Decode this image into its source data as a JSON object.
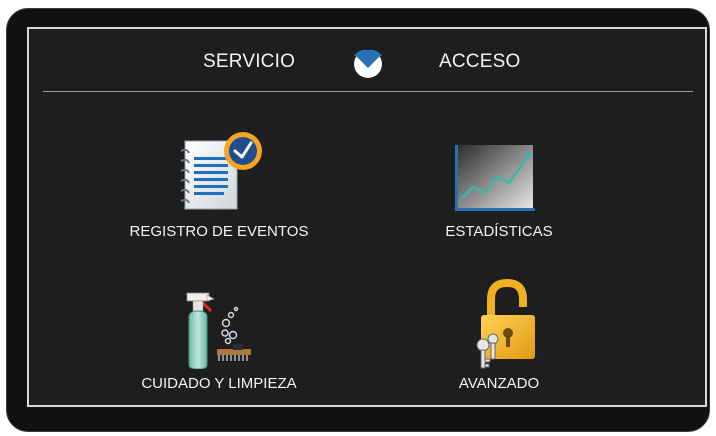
{
  "header": {
    "left_tab": "SERVICIO",
    "right_tab": "ACCESO",
    "toggle_icon": "chevron-toggle-icon"
  },
  "menu": {
    "items": [
      {
        "label": "REGISTRO DE EVENTOS",
        "icon": "event-log-icon"
      },
      {
        "label": "ESTADÍSTICAS",
        "icon": "statistics-chart-icon"
      },
      {
        "label": "CUIDADO Y LIMPIEZA",
        "icon": "cleaning-spray-icon"
      },
      {
        "label": "AVANZADO",
        "icon": "padlock-keys-icon"
      }
    ]
  },
  "colors": {
    "accent_blue": "#2a6fb8",
    "clock_orange": "#f4a623",
    "lock_gold": "#f2b01e",
    "panel_bg": "#1e1e1e",
    "text": "#f2f2f2"
  }
}
